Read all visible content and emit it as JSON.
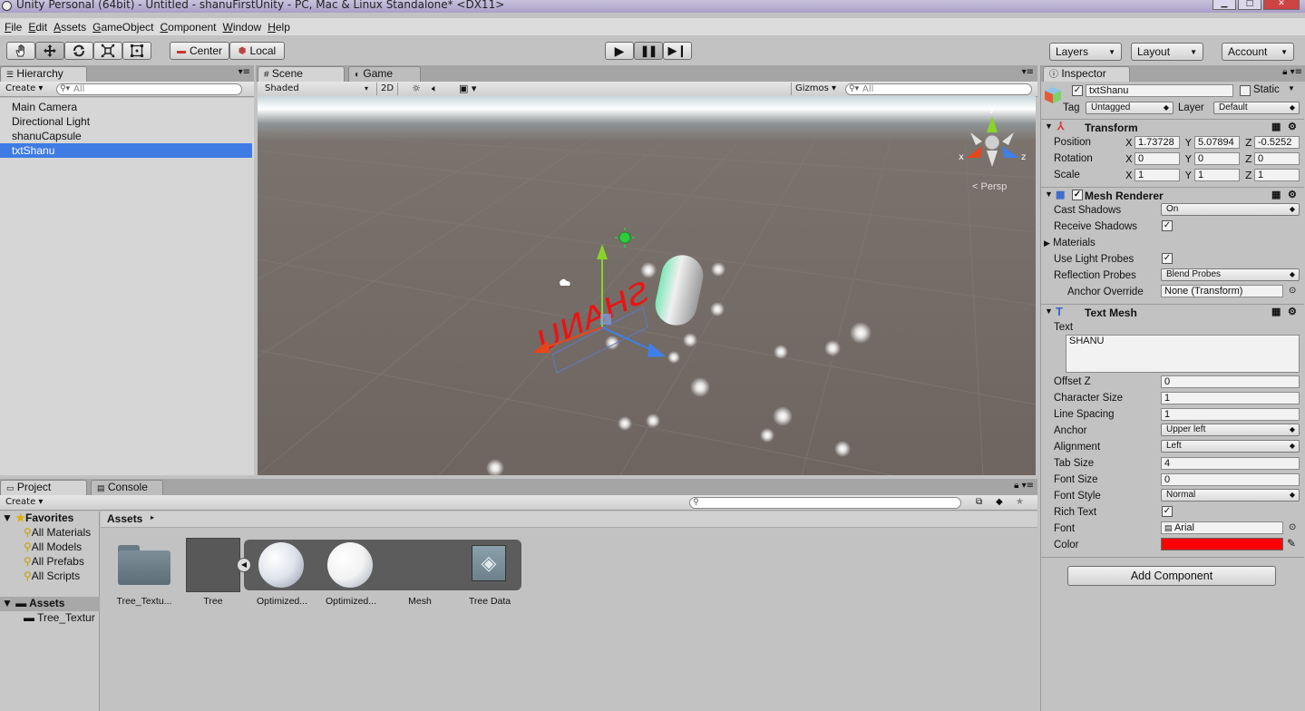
{
  "window": {
    "title": "Unity Personal (64bit) - Untitled - shanuFirstUnity - PC, Mac & Linux Standalone* <DX11>"
  },
  "menu": [
    "File",
    "Edit",
    "Assets",
    "GameObject",
    "Component",
    "Window",
    "Help"
  ],
  "toolbar": {
    "pivot_label": "Center",
    "space_label": "Local",
    "layers_label": "Layers",
    "layout_label": "Layout",
    "account_label": "Account"
  },
  "hierarchy": {
    "tab_label": "Hierarchy",
    "create_label": "Create",
    "search_placeholder": "All",
    "items": [
      "Main Camera",
      "Directional Light",
      "shanuCapsule",
      "txtShanu"
    ],
    "selected_index": 3
  },
  "scene": {
    "tab_scene": "Scene",
    "tab_game": "Game",
    "shading_mode": "Shaded",
    "mode_2d": "2D",
    "gizmos_label": "Gizmos",
    "search_placeholder": "All",
    "persp_label": "Persp",
    "gizmo_axes": {
      "x": "x",
      "y": "y",
      "z": "z"
    }
  },
  "inspector": {
    "tab_label": "Inspector",
    "object_name": "txtShanu",
    "static_label": "Static",
    "tag_label": "Tag",
    "tag_value": "Untagged",
    "layer_label": "Layer",
    "layer_value": "Default",
    "transform": {
      "title": "Transform",
      "position_label": "Position",
      "rotation_label": "Rotation",
      "scale_label": "Scale",
      "position": [
        "1.73728",
        "5.07894",
        "-0.5252"
      ],
      "rotation": [
        "0",
        "0",
        "0"
      ],
      "scale": [
        "1",
        "1",
        "1"
      ]
    },
    "mesh_renderer": {
      "title": "Mesh Renderer",
      "cast_shadows_label": "Cast Shadows",
      "cast_shadows_value": "On",
      "receive_shadows_label": "Receive Shadows",
      "materials_label": "Materials",
      "use_light_probes_label": "Use Light Probes",
      "reflection_probes_label": "Reflection Probes",
      "reflection_probes_value": "Blend Probes",
      "anchor_override_label": "Anchor Override",
      "anchor_override_value": "None (Transform)"
    },
    "text_mesh": {
      "title": "Text Mesh",
      "text_label": "Text",
      "text_value": "SHANU",
      "offset_z_label": "Offset Z",
      "offset_z_value": "0",
      "character_size_label": "Character Size",
      "character_size_value": "1",
      "line_spacing_label": "Line Spacing",
      "line_spacing_value": "1",
      "anchor_label": "Anchor",
      "anchor_value": "Upper left",
      "alignment_label": "Alignment",
      "alignment_value": "Left",
      "tab_size_label": "Tab Size",
      "tab_size_value": "4",
      "font_size_label": "Font Size",
      "font_size_value": "0",
      "font_style_label": "Font Style",
      "font_style_value": "Normal",
      "rich_text_label": "Rich Text",
      "font_label": "Font",
      "font_value": "Arial",
      "color_label": "Color",
      "color_value": "#ff0000"
    },
    "add_component_label": "Add Component"
  },
  "project": {
    "tab_project": "Project",
    "tab_console": "Console",
    "create_label": "Create",
    "favorites_label": "Favorites",
    "favorites": [
      "All Materials",
      "All Models",
      "All Prefabs",
      "All Scripts"
    ],
    "assets_label": "Assets",
    "asset_folders": [
      "Tree_Textur"
    ],
    "breadcrumb": "Assets",
    "assets": [
      {
        "label": "Tree_Textu...",
        "kind": "folder"
      },
      {
        "label": "Tree",
        "kind": "prefab"
      },
      {
        "label": "Optimized...",
        "kind": "material"
      },
      {
        "label": "Optimized...",
        "kind": "material"
      },
      {
        "label": "Mesh",
        "kind": "mesh"
      },
      {
        "label": "Tree Data",
        "kind": "unity-asset"
      }
    ]
  }
}
